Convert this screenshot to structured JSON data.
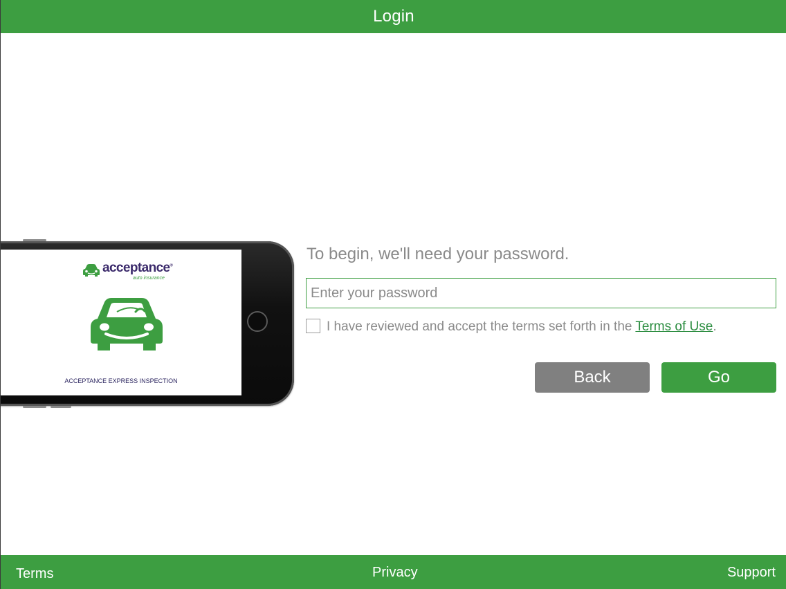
{
  "header": {
    "title": "Login"
  },
  "illustration": {
    "brand_name": "acceptance",
    "brand_registered": "®",
    "brand_tagline": "auto insurance",
    "screen_caption": "ACCEPTANCE EXPRESS INSPECTION"
  },
  "form": {
    "prompt": "To begin, we'll need your password.",
    "password_placeholder": "Enter your password",
    "password_value": "",
    "terms_text": "I have reviewed and accept the terms set forth in the ",
    "terms_link_label": "Terms of Use",
    "terms_suffix": ".",
    "back_label": "Back",
    "go_label": "Go"
  },
  "footer": {
    "terms_label": "Terms",
    "privacy_label": "Privacy",
    "support_label": "Support"
  },
  "colors": {
    "brand_green": "#3d9e41",
    "button_gray": "#808080",
    "text_gray": "#8a8a8a",
    "brand_purple": "#3b2a6b"
  }
}
